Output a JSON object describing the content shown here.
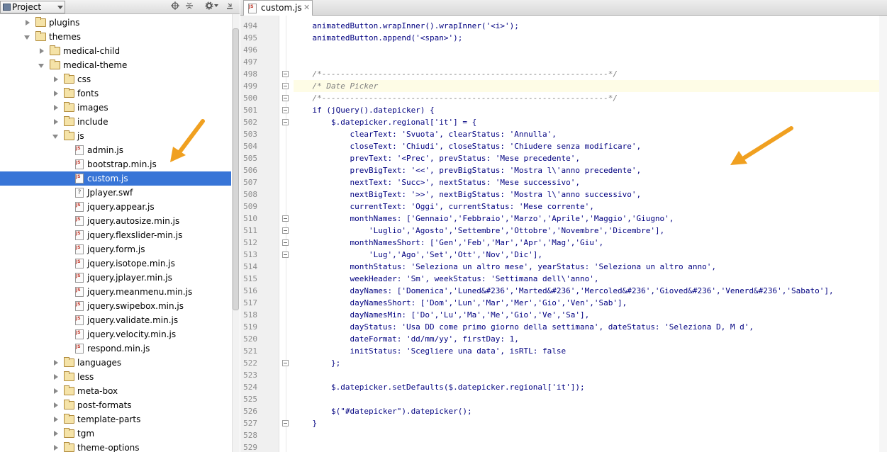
{
  "panel": {
    "title": "Project",
    "tree": [
      {
        "label": "plugins",
        "type": "folder",
        "depth": 2,
        "state": "closed"
      },
      {
        "label": "themes",
        "type": "folder",
        "depth": 2,
        "state": "open"
      },
      {
        "label": "medical-child",
        "type": "folder",
        "depth": 3,
        "state": "closed"
      },
      {
        "label": "medical-theme",
        "type": "folder",
        "depth": 3,
        "state": "open"
      },
      {
        "label": "css",
        "type": "folder",
        "depth": 4,
        "state": "closed"
      },
      {
        "label": "fonts",
        "type": "folder",
        "depth": 4,
        "state": "closed"
      },
      {
        "label": "images",
        "type": "folder",
        "depth": 4,
        "state": "closed"
      },
      {
        "label": "include",
        "type": "folder",
        "depth": 4,
        "state": "closed"
      },
      {
        "label": "js",
        "type": "folder",
        "depth": 4,
        "state": "open"
      },
      {
        "label": "admin.js",
        "type": "js",
        "depth": 5
      },
      {
        "label": "bootstrap.min.js",
        "type": "js",
        "depth": 5
      },
      {
        "label": "custom.js",
        "type": "js",
        "depth": 5,
        "selected": true
      },
      {
        "label": "Jplayer.swf",
        "type": "swf",
        "depth": 5
      },
      {
        "label": "jquery.appear.js",
        "type": "js",
        "depth": 5
      },
      {
        "label": "jquery.autosize.min.js",
        "type": "js",
        "depth": 5
      },
      {
        "label": "jquery.flexslider-min.js",
        "type": "js",
        "depth": 5
      },
      {
        "label": "jquery.form.js",
        "type": "js",
        "depth": 5
      },
      {
        "label": "jquery.isotope.min.js",
        "type": "js",
        "depth": 5
      },
      {
        "label": "jquery.jplayer.min.js",
        "type": "js",
        "depth": 5
      },
      {
        "label": "jquery.meanmenu.min.js",
        "type": "js",
        "depth": 5
      },
      {
        "label": "jquery.swipebox.min.js",
        "type": "js",
        "depth": 5
      },
      {
        "label": "jquery.validate.min.js",
        "type": "js",
        "depth": 5
      },
      {
        "label": "jquery.velocity.min.js",
        "type": "js",
        "depth": 5
      },
      {
        "label": "respond.min.js",
        "type": "js",
        "depth": 5
      },
      {
        "label": "languages",
        "type": "folder",
        "depth": 4,
        "state": "closed"
      },
      {
        "label": "less",
        "type": "folder",
        "depth": 4,
        "state": "closed"
      },
      {
        "label": "meta-box",
        "type": "folder",
        "depth": 4,
        "state": "closed"
      },
      {
        "label": "post-formats",
        "type": "folder",
        "depth": 4,
        "state": "closed"
      },
      {
        "label": "template-parts",
        "type": "folder",
        "depth": 4,
        "state": "closed"
      },
      {
        "label": "tgm",
        "type": "folder",
        "depth": 4,
        "state": "closed"
      },
      {
        "label": "theme-options",
        "type": "folder",
        "depth": 4,
        "state": "closed"
      }
    ]
  },
  "editor": {
    "tab_label": "custom.js",
    "highlighted_line": 499,
    "lines": [
      {
        "num": "494",
        "text": "    animatedButton.wrapInner().wrapInner('<i>');"
      },
      {
        "num": "495",
        "text": "    animatedButton.append('<span>');"
      },
      {
        "num": "496",
        "text": ""
      },
      {
        "num": "497",
        "text": ""
      },
      {
        "num": "498",
        "text": "    /*-------------------------------------------------------------*/",
        "kind": "comment"
      },
      {
        "num": "499",
        "text": "    /* Date Picker",
        "kind": "comment"
      },
      {
        "num": "500",
        "text": "    /*-------------------------------------------------------------*/",
        "kind": "comment"
      },
      {
        "num": "501",
        "text": "    if (jQuery().datepicker) {"
      },
      {
        "num": "502",
        "text": "        $.datepicker.regional['it'] = {"
      },
      {
        "num": "503",
        "text": "            clearText: 'Svuota', clearStatus: 'Annulla',"
      },
      {
        "num": "504",
        "text": "            closeText: 'Chiudi', closeStatus: 'Chiudere senza modificare',"
      },
      {
        "num": "505",
        "text": "            prevText: '<Prec', prevStatus: 'Mese precedente',"
      },
      {
        "num": "506",
        "text": "            prevBigText: '<<', prevBigStatus: 'Mostra l\\'anno precedente',"
      },
      {
        "num": "507",
        "text": "            nextText: 'Succ>', nextStatus: 'Mese successivo',"
      },
      {
        "num": "508",
        "text": "            nextBigText: '>>', nextBigStatus: 'Mostra l\\'anno successivo',"
      },
      {
        "num": "509",
        "text": "            currentText: 'Oggi', currentStatus: 'Mese corrente',"
      },
      {
        "num": "510",
        "text": "            monthNames: ['Gennaio','Febbraio','Marzo','Aprile','Maggio','Giugno',"
      },
      {
        "num": "511",
        "text": "                'Luglio','Agosto','Settembre','Ottobre','Novembre','Dicembre'],"
      },
      {
        "num": "512",
        "text": "            monthNamesShort: ['Gen','Feb','Mar','Apr','Mag','Giu',"
      },
      {
        "num": "513",
        "text": "                'Lug','Ago','Set','Ott','Nov','Dic'],"
      },
      {
        "num": "514",
        "text": "            monthStatus: 'Seleziona un altro mese', yearStatus: 'Seleziona un altro anno',"
      },
      {
        "num": "515",
        "text": "            weekHeader: 'Sm', weekStatus: 'Settimana dell\\'anno',"
      },
      {
        "num": "516",
        "text": "            dayNames: ['Domenica','Luned&#236','Marted&#236','Mercoled&#236','Gioved&#236','Venerd&#236','Sabato'],"
      },
      {
        "num": "517",
        "text": "            dayNamesShort: ['Dom','Lun','Mar','Mer','Gio','Ven','Sab'],"
      },
      {
        "num": "518",
        "text": "            dayNamesMin: ['Do','Lu','Ma','Me','Gio','Ve','Sa'],"
      },
      {
        "num": "519",
        "text": "            dayStatus: 'Usa DD come primo giorno della settimana', dateStatus: 'Seleziona D, M d',"
      },
      {
        "num": "520",
        "text": "            dateFormat: 'dd/mm/yy', firstDay: 1,"
      },
      {
        "num": "521",
        "text": "            initStatus: 'Scegliere una data', isRTL: false"
      },
      {
        "num": "522",
        "text": "        };"
      },
      {
        "num": "523",
        "text": ""
      },
      {
        "num": "524",
        "text": "        $.datepicker.setDefaults($.datepicker.regional['it']);"
      },
      {
        "num": "525",
        "text": ""
      },
      {
        "num": "526",
        "text": "        $(\"#datepicker\").datepicker();"
      },
      {
        "num": "527",
        "text": "    }"
      },
      {
        "num": "528",
        "text": ""
      },
      {
        "num": "529",
        "text": ""
      }
    ],
    "fold_lines": [
      "498",
      "499",
      "500",
      "501",
      "502",
      "510",
      "511",
      "512",
      "513",
      "522",
      "527"
    ]
  },
  "colors": {
    "selection": "#3875d7",
    "arrow": "#f0a020",
    "string": "#008000",
    "comment": "#808080",
    "keyword": "#000080"
  },
  "icons": {
    "header": [
      "locate-icon",
      "collapse-all-icon",
      "settings-icon",
      "hide-panel-icon"
    ],
    "tab": "js-file-icon"
  }
}
